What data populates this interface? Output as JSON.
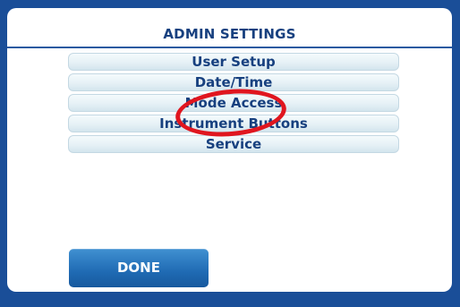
{
  "header": {
    "title": "ADMIN SETTINGS"
  },
  "menu": {
    "items": [
      {
        "label": "User Setup"
      },
      {
        "label": "Date/Time"
      },
      {
        "label": "Mode Access"
      },
      {
        "label": "Instrument Buttons"
      },
      {
        "label": "Service"
      }
    ]
  },
  "footer": {
    "done_label": "DONE"
  },
  "annotation": {
    "highlight_color": "#e0161f",
    "highlighted_item": "Mode Access"
  },
  "theme": {
    "background": "#1a4e98",
    "text": "#17407f",
    "button": "#1f6ab3"
  }
}
